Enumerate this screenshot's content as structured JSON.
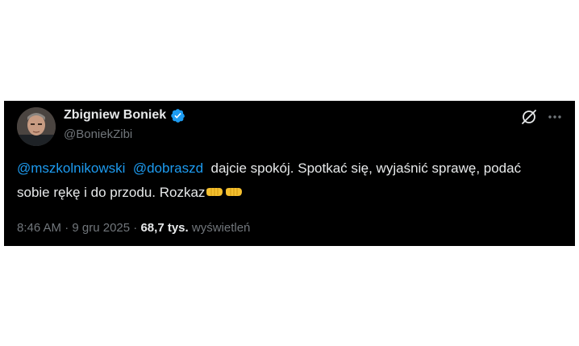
{
  "author": {
    "name": "Zbigniew Boniek",
    "handle": "@BoniekZibi"
  },
  "tweet": {
    "mention_1": "@mszkolnikowski",
    "mention_2": "@dobraszd",
    "text": "dajcie spokój. Spotkać się, wyjaśnić sprawę, podać sobie rękę i do przodu. Rozkaz",
    "emojis": [
      "salute-fist-emoji",
      "salute-fist-emoji"
    ]
  },
  "meta": {
    "time": "8:46 AM",
    "separator": "·",
    "date": "9 gru 2025",
    "views_count": "68,7 tys.",
    "views_label": "wyświetleń"
  },
  "colors": {
    "background": "#000000",
    "text": "#e7e9ea",
    "secondary": "#71767b",
    "link": "#1d9bf0",
    "verified": "#1d9bf0"
  }
}
